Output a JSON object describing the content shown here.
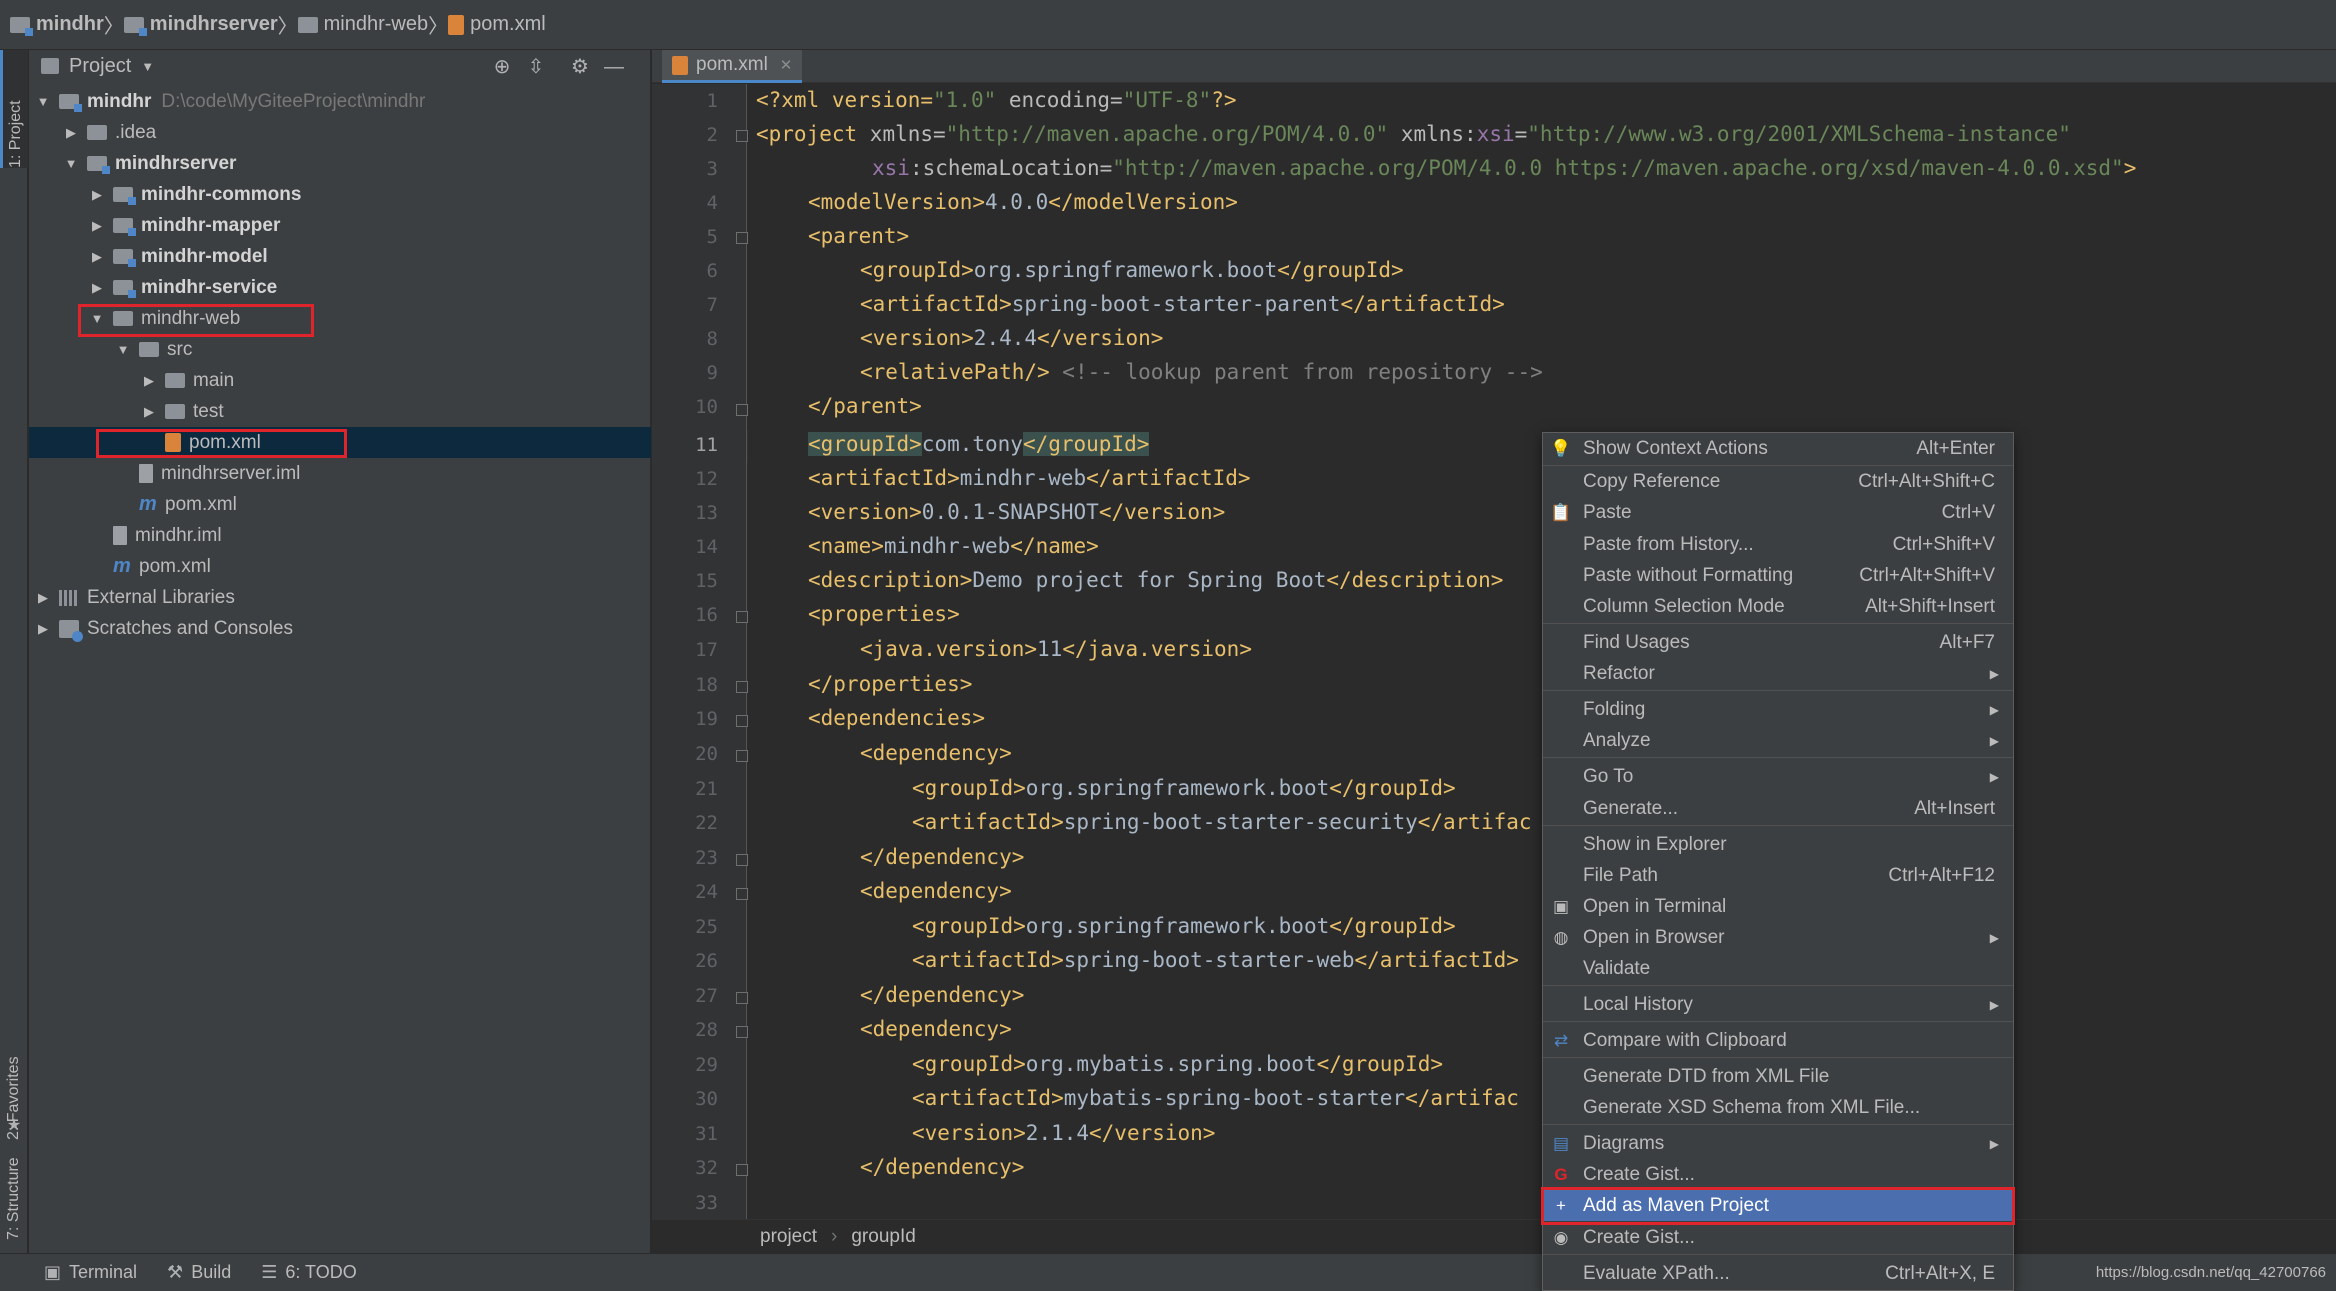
{
  "breadcrumbs": [
    "mindhr",
    "mindhrserver",
    "mindhr-web",
    "pom.xml"
  ],
  "left_stripe": {
    "project_tab": "1: Project",
    "favorites_tab": "2: Favorites",
    "structure_tab": "7: Structure"
  },
  "project_panel": {
    "title": "Project",
    "tree": [
      {
        "label": "mindhr",
        "path": "D:\\code\\MyGiteeProject\\mindhr"
      },
      {
        "label": ".idea"
      },
      {
        "label": "mindhrserver"
      },
      {
        "label": "mindhr-commons"
      },
      {
        "label": "mindhr-mapper"
      },
      {
        "label": "mindhr-model"
      },
      {
        "label": "mindhr-service"
      },
      {
        "label": "mindhr-web"
      },
      {
        "label": "src"
      },
      {
        "label": "main"
      },
      {
        "label": "test"
      },
      {
        "label": "pom.xml"
      },
      {
        "label": "mindhrserver.iml"
      },
      {
        "label": "pom.xml"
      },
      {
        "label": "mindhr.iml"
      },
      {
        "label": "pom.xml"
      },
      {
        "label": "External Libraries"
      },
      {
        "label": "Scratches and Consoles"
      }
    ]
  },
  "editor": {
    "tab_label": "pom.xml",
    "line_numbers": [
      "1",
      "2",
      "3",
      "4",
      "5",
      "6",
      "7",
      "8",
      "9",
      "10",
      "11",
      "12",
      "13",
      "14",
      "15",
      "16",
      "17",
      "18",
      "19",
      "20",
      "21",
      "22",
      "23",
      "24",
      "25",
      "26",
      "27",
      "28",
      "29",
      "30",
      "31",
      "32",
      "33"
    ],
    "code": {
      "l1": {
        "a": "<?xml version=",
        "b": "\"1.0\"",
        "c": " encoding=",
        "d": "\"UTF-8\"",
        "e": "?>"
      },
      "l2": {
        "a": "<project ",
        "b": "xmlns=",
        "c": "\"http://maven.apache.org/POM/4.0.0\"",
        "d": " xmlns:",
        "e": "xsi",
        "f": "=",
        "g": "\"http://www.w3.org/2001/XMLSchema-instance\""
      },
      "l3": {
        "a": "xsi",
        "b": ":schemaLocation=",
        "c": "\"http://maven.apache.org/POM/4.0.0 https://maven.apache.org/xsd/maven-4.0.0.xsd\"",
        "d": ">"
      },
      "l4": {
        "o": "<modelVersion>",
        "v": "4.0.0",
        "c": "</modelVersion>"
      },
      "l5": {
        "o": "<parent>"
      },
      "l6": {
        "o": "<groupId>",
        "v": "org.springframework.boot",
        "c": "</groupId>"
      },
      "l7": {
        "o": "<artifactId>",
        "v": "spring-boot-starter-parent",
        "c": "</artifactId>"
      },
      "l8": {
        "o": "<version>",
        "v": "2.4.4",
        "c": "</version>"
      },
      "l9": {
        "o": "<relativePath/>",
        "cm": " <!-- lookup parent from repository -->"
      },
      "l10": {
        "o": "</parent>"
      },
      "l11": {
        "o": "<groupId>",
        "v": "com.tony",
        "c": "</groupId>"
      },
      "l12": {
        "o": "<artifactId>",
        "v": "mindhr-web",
        "c": "</artifactId>"
      },
      "l13": {
        "o": "<version>",
        "v": "0.0.1-SNAPSHOT",
        "c": "</version>"
      },
      "l14": {
        "o": "<name>",
        "v": "mindhr-web",
        "c": "</name>"
      },
      "l15": {
        "o": "<description>",
        "v": "Demo project for Spring Boot",
        "c": "</description>"
      },
      "l16": {
        "o": "<properties>"
      },
      "l17": {
        "o": "<java.version>",
        "v": "11",
        "c": "</java.version>"
      },
      "l18": {
        "o": "</properties>"
      },
      "l19": {
        "o": "<dependencies>"
      },
      "l20": {
        "o": "<dependency>"
      },
      "l21": {
        "o": "<groupId>",
        "v": "org.springframework.boot",
        "c": "</groupId>"
      },
      "l22": {
        "o": "<artifactId>",
        "v": "spring-boot-starter-security",
        "c": "</artifac"
      },
      "l23": {
        "o": "</dependency>"
      },
      "l24": {
        "o": "<dependency>"
      },
      "l25": {
        "o": "<groupId>",
        "v": "org.springframework.boot",
        "c": "</groupId>"
      },
      "l26": {
        "o": "<artifactId>",
        "v": "spring-boot-starter-web",
        "c": "</artifactId>"
      },
      "l27": {
        "o": "</dependency>"
      },
      "l28": {
        "o": "<dependency>"
      },
      "l29": {
        "o": "<groupId>",
        "v": "org.mybatis.spring.boot",
        "c": "</groupId>"
      },
      "l30": {
        "o": "<artifactId>",
        "v": "mybatis-spring-boot-starter",
        "c": "</artifac"
      },
      "l31": {
        "o": "<version>",
        "v": "2.1.4",
        "c": "</version>"
      },
      "l32": {
        "o": "</dependency>"
      }
    }
  },
  "editor_breadcrumb": [
    "project",
    "groupId"
  ],
  "context_menu": {
    "items": [
      {
        "label": "Show Context Actions",
        "shortcut": "Alt+Enter",
        "icon": "bulb-icon"
      },
      {
        "label": "Copy Reference",
        "shortcut": "Ctrl+Alt+Shift+C"
      },
      {
        "label": "Paste",
        "shortcut": "Ctrl+V",
        "icon": "clipboard-icon"
      },
      {
        "label": "Paste from History...",
        "shortcut": "Ctrl+Shift+V"
      },
      {
        "label": "Paste without Formatting",
        "shortcut": "Ctrl+Alt+Shift+V"
      },
      {
        "label": "Column Selection Mode",
        "shortcut": "Alt+Shift+Insert"
      },
      {
        "label": "Find Usages",
        "shortcut": "Alt+F7"
      },
      {
        "label": "Refactor",
        "shortcut": ""
      },
      {
        "label": "Folding",
        "shortcut": ""
      },
      {
        "label": "Analyze",
        "shortcut": ""
      },
      {
        "label": "Go To",
        "shortcut": ""
      },
      {
        "label": "Generate...",
        "shortcut": "Alt+Insert"
      },
      {
        "label": "Show in Explorer",
        "shortcut": ""
      },
      {
        "label": "File Path",
        "shortcut": "Ctrl+Alt+F12"
      },
      {
        "label": "Open in Terminal",
        "shortcut": "",
        "icon": "terminal-icon"
      },
      {
        "label": "Open in Browser",
        "shortcut": "",
        "icon": "globe-icon"
      },
      {
        "label": "Validate",
        "shortcut": ""
      },
      {
        "label": "Local History",
        "shortcut": ""
      },
      {
        "label": "Compare with Clipboard",
        "shortcut": "",
        "icon": "compare-icon"
      },
      {
        "label": "Generate DTD from XML File",
        "shortcut": ""
      },
      {
        "label": "Generate XSD Schema from XML File...",
        "shortcut": ""
      },
      {
        "label": "Diagrams",
        "shortcut": "",
        "icon": "diagram-icon"
      },
      {
        "label": "Create Gist...",
        "shortcut": "",
        "icon": "gitee-icon"
      },
      {
        "label": "Add as Maven Project",
        "shortcut": "",
        "icon": "plus-icon"
      },
      {
        "label": "Create Gist...",
        "shortcut": "",
        "icon": "github-icon"
      },
      {
        "label": "Evaluate XPath...",
        "shortcut": "Ctrl+Alt+X, E"
      }
    ]
  },
  "bottom_bar": {
    "terminal": "Terminal",
    "build": "Build",
    "todo": "6: TODO"
  },
  "status_url": "https://blog.csdn.net/qq_42700766",
  "colors": {
    "highlight_box": "#e0242b",
    "menu_active": "#4b6eaf",
    "xml_tag": "#e8bf6a",
    "string": "#6a8759"
  }
}
